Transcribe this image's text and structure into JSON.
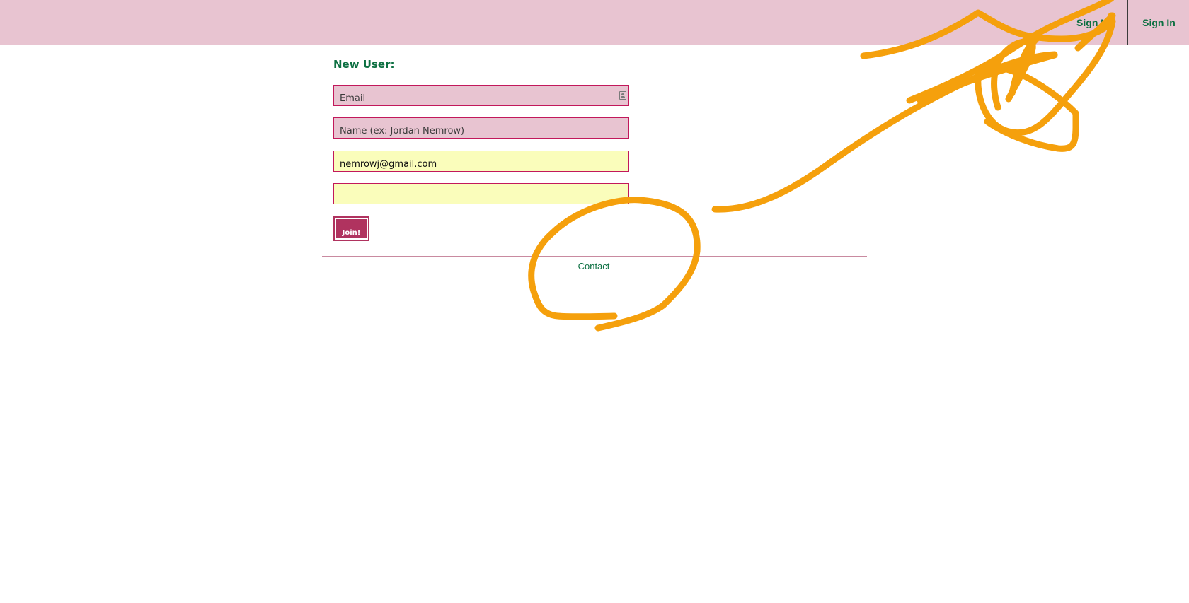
{
  "colors": {
    "topbar_bg": "#e8c4d1",
    "accent_green": "#0d7042",
    "field_border": "#c2185b",
    "field_pink": "#e8c4d1",
    "field_yellow_autofill": "#fafdbb",
    "button_bg": "#b0335f",
    "annotation_orange": "#f5a00c"
  },
  "header": {
    "nav": {
      "sign_up_label": "Sign Up",
      "sign_in_label": "Sign In"
    }
  },
  "form": {
    "heading": "New User:",
    "email": {
      "placeholder": "Email",
      "value": "",
      "icon": "contact-card-icon"
    },
    "name": {
      "placeholder": "Name (ex: Jordan Nemrow)",
      "value": ""
    },
    "confirm": {
      "value": "nemrowj@gmail.com"
    },
    "password": {
      "value": ""
    },
    "submit_label": "Join!"
  },
  "footer": {
    "contact_label": "Contact"
  }
}
